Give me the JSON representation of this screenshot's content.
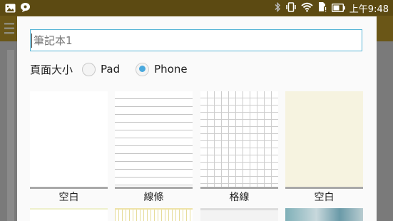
{
  "status_bar": {
    "time": "上午9:48",
    "left_icons": [
      "image-icon",
      "chat-bubble-icon"
    ],
    "right_icons": [
      "bluetooth-icon",
      "vibrate-icon",
      "wifi-icon",
      "sim-alert-icon",
      "battery-icon"
    ]
  },
  "dialog": {
    "name_field": {
      "placeholder": "筆記本1",
      "value": ""
    },
    "page_size": {
      "label": "頁面大小",
      "options": [
        {
          "label": "Pad",
          "selected": false
        },
        {
          "label": "Phone",
          "selected": true
        }
      ]
    },
    "templates": [
      {
        "label": "空白",
        "style": "blank"
      },
      {
        "label": "線條",
        "style": "lined"
      },
      {
        "label": "格線",
        "style": "grid"
      },
      {
        "label": "空白",
        "style": "cream"
      }
    ]
  },
  "colors": {
    "status_bar": "#5c4a12",
    "accent": "#49a8dd",
    "input_border": "#58b5d6"
  }
}
